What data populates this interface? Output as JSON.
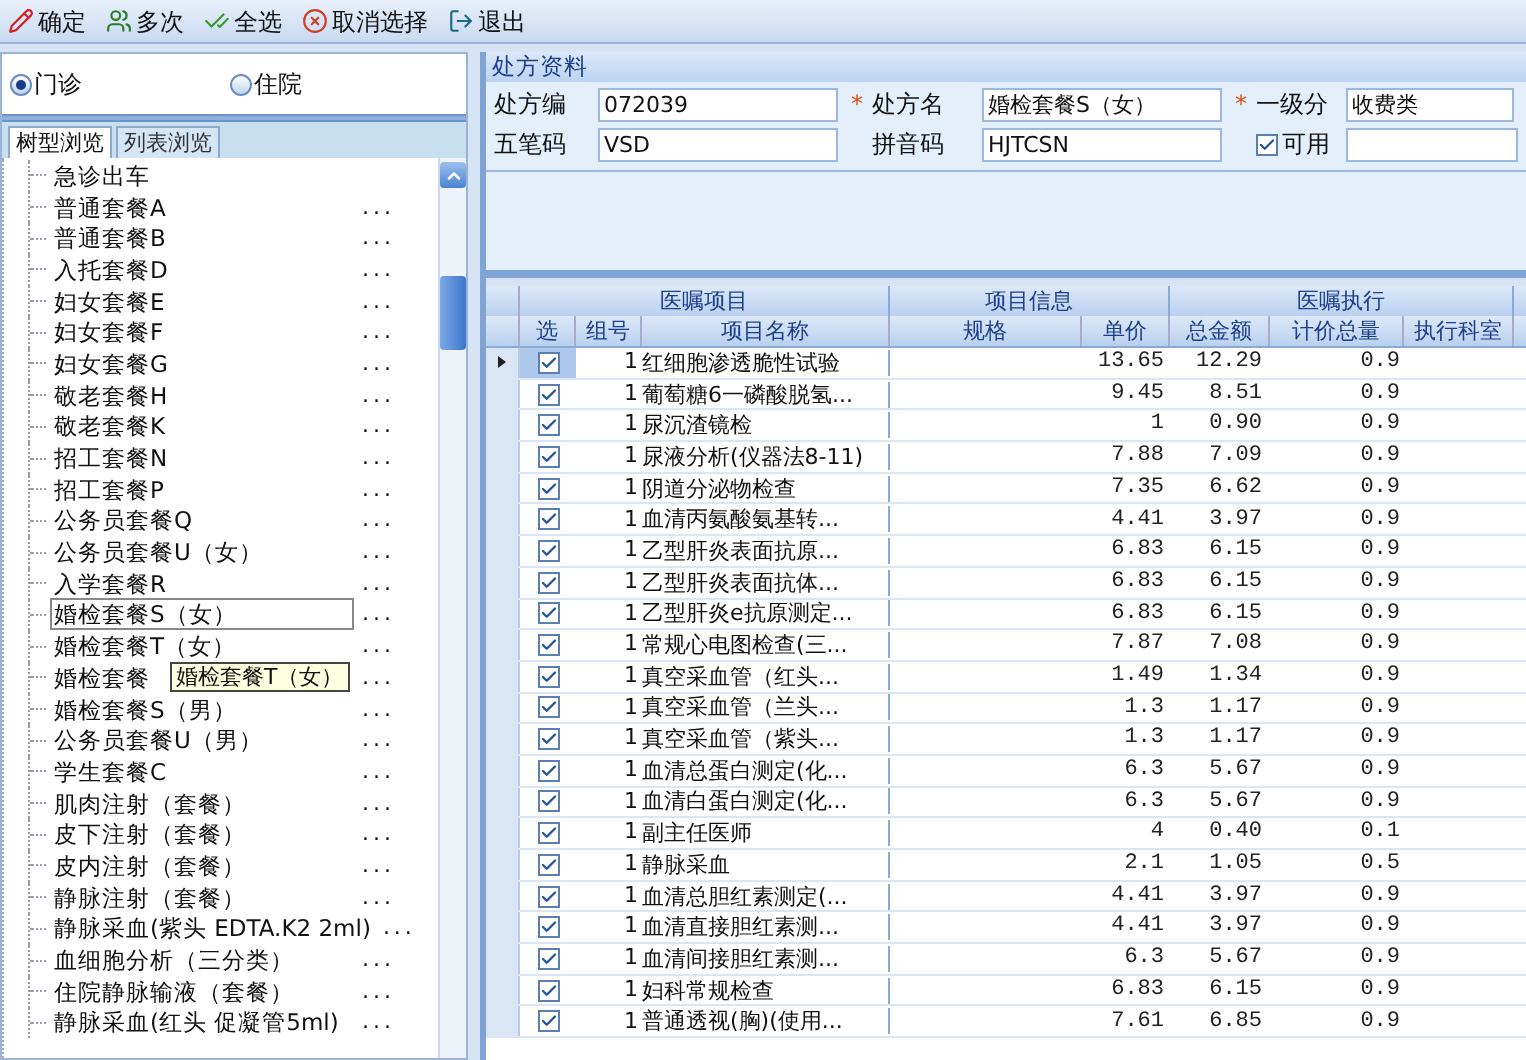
{
  "toolbar": [
    {
      "label": "确定"
    },
    {
      "label": "多次"
    },
    {
      "label": "全选"
    },
    {
      "label": "取消选择"
    },
    {
      "label": "退出"
    }
  ],
  "visit_type": [
    {
      "label": "门诊",
      "selected": true
    },
    {
      "label": "住院",
      "selected": false
    }
  ],
  "tabs": [
    {
      "label": "树型浏览",
      "selected": true
    },
    {
      "label": "列表浏览",
      "selected": false
    }
  ],
  "tree": {
    "items": [
      {
        "label": "急诊出车",
        "selected": false,
        "more": false
      },
      {
        "label": "普通套餐A",
        "selected": false,
        "more": true
      },
      {
        "label": "普通套餐B",
        "selected": false,
        "more": true
      },
      {
        "label": "入托套餐D",
        "selected": false,
        "more": true
      },
      {
        "label": "妇女套餐E",
        "selected": false,
        "more": true
      },
      {
        "label": "妇女套餐F",
        "selected": false,
        "more": true
      },
      {
        "label": "妇女套餐G",
        "selected": false,
        "more": true
      },
      {
        "label": "敬老套餐H",
        "selected": false,
        "more": true
      },
      {
        "label": "敬老套餐K",
        "selected": false,
        "more": true
      },
      {
        "label": "招工套餐N",
        "selected": false,
        "more": true
      },
      {
        "label": "招工套餐P",
        "selected": false,
        "more": true
      },
      {
        "label": "公务员套餐Q",
        "selected": false,
        "more": true
      },
      {
        "label": "公务员套餐U（女）",
        "selected": false,
        "more": true
      },
      {
        "label": "入学套餐R",
        "selected": false,
        "more": true
      },
      {
        "label": "婚检套餐S（女）",
        "selected": true,
        "more": true
      },
      {
        "label": "婚检套餐T（女）",
        "selected": false,
        "more": true
      },
      {
        "label": "婚检套餐",
        "selected": false,
        "more": true,
        "tooltip": "婚检套餐T（女）"
      },
      {
        "label": "婚检套餐S（男）",
        "selected": false,
        "more": true
      },
      {
        "label": "公务员套餐U（男）",
        "selected": false,
        "more": true
      },
      {
        "label": "学生套餐C",
        "selected": false,
        "more": true
      },
      {
        "label": "肌肉注射（套餐）",
        "selected": false,
        "more": true
      },
      {
        "label": "皮下注射（套餐）",
        "selected": false,
        "more": true
      },
      {
        "label": "皮内注射（套餐）",
        "selected": false,
        "more": true
      },
      {
        "label": "静脉注射（套餐）",
        "selected": false,
        "more": true
      },
      {
        "label": "静脉采血(紫头 EDTA.K2 2ml)",
        "selected": false,
        "more": true
      },
      {
        "label": "血细胞分析（三分类）",
        "selected": false,
        "more": true
      },
      {
        "label": "住院静脉输液（套餐）",
        "selected": false,
        "more": true
      },
      {
        "label": "静脉采血(红头 促凝管5ml)",
        "selected": false,
        "more": true
      }
    ],
    "more_label": "..."
  },
  "form": {
    "title": "处方资料",
    "fields": [
      {
        "label": "处方编",
        "value": "072039",
        "required": false
      },
      {
        "label": "处方名",
        "value": "婚检套餐S（女）",
        "required": true
      },
      {
        "label": "一级分",
        "value": "收费类",
        "required": true
      },
      {
        "label": "五笔码",
        "value": "VSD",
        "required": false
      },
      {
        "label": "拼音码",
        "value": "HJTCSN",
        "required": false
      }
    ],
    "enabled": {
      "label": "可用",
      "checked": true
    },
    "required_mark": "*"
  },
  "table": {
    "column_groups": [
      {
        "label": "医嘱项目",
        "columns": [
          "选",
          "组号",
          "项目名称"
        ]
      },
      {
        "label": "项目信息",
        "columns": [
          "规格",
          "单价"
        ]
      },
      {
        "label": "医嘱执行",
        "columns": [
          "总金额",
          "计价总量",
          "执行科室"
        ]
      }
    ],
    "rows": [
      {
        "current": true,
        "checked": true,
        "group": "1",
        "name": "红细胞渗透脆性试验",
        "price": "13.65",
        "total": "12.29",
        "qty": "0.9"
      },
      {
        "current": false,
        "checked": true,
        "group": "1",
        "name": "葡萄糖6一磷酸脱氢...",
        "price": "9.45",
        "total": "8.51",
        "qty": "0.9"
      },
      {
        "current": false,
        "checked": true,
        "group": "1",
        "name": "尿沉渣镜检",
        "price": "1",
        "total": "0.90",
        "qty": "0.9"
      },
      {
        "current": false,
        "checked": true,
        "group": "1",
        "name": "尿液分析(仪器法8-11)",
        "price": "7.88",
        "total": "7.09",
        "qty": "0.9"
      },
      {
        "current": false,
        "checked": true,
        "group": "1",
        "name": "阴道分泌物检查",
        "price": "7.35",
        "total": "6.62",
        "qty": "0.9"
      },
      {
        "current": false,
        "checked": true,
        "group": "1",
        "name": "血清丙氨酸氨基转...",
        "price": "4.41",
        "total": "3.97",
        "qty": "0.9"
      },
      {
        "current": false,
        "checked": true,
        "group": "1",
        "name": "乙型肝炎表面抗原...",
        "price": "6.83",
        "total": "6.15",
        "qty": "0.9"
      },
      {
        "current": false,
        "checked": true,
        "group": "1",
        "name": "乙型肝炎表面抗体...",
        "price": "6.83",
        "total": "6.15",
        "qty": "0.9"
      },
      {
        "current": false,
        "checked": true,
        "group": "1",
        "name": "乙型肝炎e抗原测定...",
        "price": "6.83",
        "total": "6.15",
        "qty": "0.9"
      },
      {
        "current": false,
        "checked": true,
        "group": "1",
        "name": "常规心电图检查(三...",
        "price": "7.87",
        "total": "7.08",
        "qty": "0.9"
      },
      {
        "current": false,
        "checked": true,
        "group": "1",
        "name": "真空采血管（红头...",
        "price": "1.49",
        "total": "1.34",
        "qty": "0.9"
      },
      {
        "current": false,
        "checked": true,
        "group": "1",
        "name": "真空采血管（兰头...",
        "price": "1.3",
        "total": "1.17",
        "qty": "0.9"
      },
      {
        "current": false,
        "checked": true,
        "group": "1",
        "name": "真空采血管（紫头...",
        "price": "1.3",
        "total": "1.17",
        "qty": "0.9"
      },
      {
        "current": false,
        "checked": true,
        "group": "1",
        "name": "血清总蛋白测定(化...",
        "price": "6.3",
        "total": "5.67",
        "qty": "0.9"
      },
      {
        "current": false,
        "checked": true,
        "group": "1",
        "name": "血清白蛋白测定(化...",
        "price": "6.3",
        "total": "5.67",
        "qty": "0.9"
      },
      {
        "current": false,
        "checked": true,
        "group": "1",
        "name": "副主任医师",
        "price": "4",
        "total": "0.40",
        "qty": "0.1"
      },
      {
        "current": false,
        "checked": true,
        "group": "1",
        "name": "静脉采血",
        "price": "2.1",
        "total": "1.05",
        "qty": "0.5"
      },
      {
        "current": false,
        "checked": true,
        "group": "1",
        "name": "血清总胆红素测定(...",
        "price": "4.41",
        "total": "3.97",
        "qty": "0.9"
      },
      {
        "current": false,
        "checked": true,
        "group": "1",
        "name": "血清直接胆红素测...",
        "price": "4.41",
        "total": "3.97",
        "qty": "0.9"
      },
      {
        "current": false,
        "checked": true,
        "group": "1",
        "name": "血清间接胆红素测...",
        "price": "6.3",
        "total": "5.67",
        "qty": "0.9"
      },
      {
        "current": false,
        "checked": true,
        "group": "1",
        "name": "妇科常规检查",
        "price": "6.83",
        "total": "6.15",
        "qty": "0.9"
      },
      {
        "current": false,
        "checked": true,
        "group": "1",
        "name": "普通透视(胸)(使用...",
        "price": "7.61",
        "total": "6.85",
        "qty": "0.9"
      }
    ]
  }
}
